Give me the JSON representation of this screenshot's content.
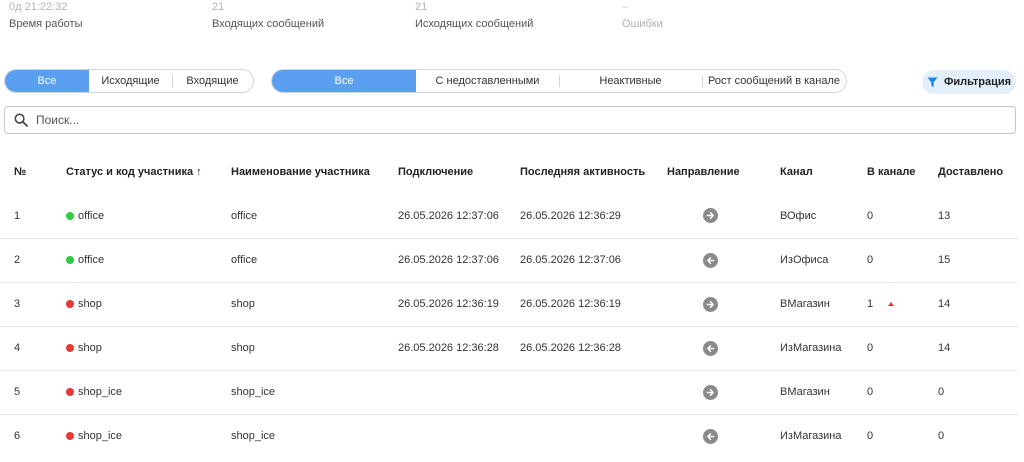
{
  "stats": [
    {
      "value": "0д 21:22:32",
      "label": "Время работы"
    },
    {
      "value": "21",
      "label": "Входящих сообщений"
    },
    {
      "value": "21",
      "label": "Исходящих сообщений"
    },
    {
      "value": "–",
      "label": "Ошибки"
    }
  ],
  "direction_filter": {
    "options": [
      "Все",
      "Исходящие",
      "Входящие"
    ],
    "selected": "Все"
  },
  "state_filter": {
    "options": [
      "Все",
      "С недоставленными",
      "Неактивные",
      "Рост сообщений в канале"
    ],
    "selected": "Все"
  },
  "filter_button": {
    "label": "Фильтрация",
    "icon": "funnel-icon",
    "color": "#1e88e5"
  },
  "search": {
    "placeholder": "Поиск...",
    "value": ""
  },
  "colors": {
    "accent": "#5a9ff0",
    "online": "#2ecc40",
    "offline": "#e53935",
    "direction_icon": "#8a8a8a"
  },
  "table": {
    "columns": [
      "№",
      "Статус и код участника ↑",
      "Наименование участника",
      "Подключение",
      "Последняя активность",
      "Направление",
      "Канал",
      "В канале",
      "Доставлено"
    ],
    "rows": [
      {
        "num": "1",
        "status": "online",
        "code": "office",
        "name": "office",
        "connected": "26.05.2026 12:37:06",
        "last_activity": "26.05.2026 12:36:29",
        "direction": "outgoing",
        "channel": "ВОфис",
        "in_channel": "0",
        "growth": false,
        "delivered": "13"
      },
      {
        "num": "2",
        "status": "online",
        "code": "office",
        "name": "office",
        "connected": "26.05.2026 12:37:06",
        "last_activity": "26.05.2026 12:37:06",
        "direction": "incoming",
        "channel": "ИзОфиса",
        "in_channel": "0",
        "growth": false,
        "delivered": "15"
      },
      {
        "num": "3",
        "status": "offline",
        "code": "shop",
        "name": "shop",
        "connected": "26.05.2026 12:36:19",
        "last_activity": "26.05.2026 12:36:19",
        "direction": "outgoing",
        "channel": "ВМагазин",
        "in_channel": "1",
        "growth": true,
        "delivered": "14"
      },
      {
        "num": "4",
        "status": "offline",
        "code": "shop",
        "name": "shop",
        "connected": "26.05.2026 12:36:28",
        "last_activity": "26.05.2026 12:36:28",
        "direction": "incoming",
        "channel": "ИзМагазина",
        "in_channel": "0",
        "growth": false,
        "delivered": "14"
      },
      {
        "num": "5",
        "status": "offline",
        "code": "shop_ice",
        "name": "shop_ice",
        "connected": "",
        "last_activity": "",
        "direction": "outgoing",
        "channel": "ВМагазин",
        "in_channel": "0",
        "growth": false,
        "delivered": "0"
      },
      {
        "num": "6",
        "status": "offline",
        "code": "shop_ice",
        "name": "shop_ice",
        "connected": "",
        "last_activity": "",
        "direction": "incoming",
        "channel": "ИзМагазина",
        "in_channel": "0",
        "growth": false,
        "delivered": "0"
      }
    ]
  }
}
